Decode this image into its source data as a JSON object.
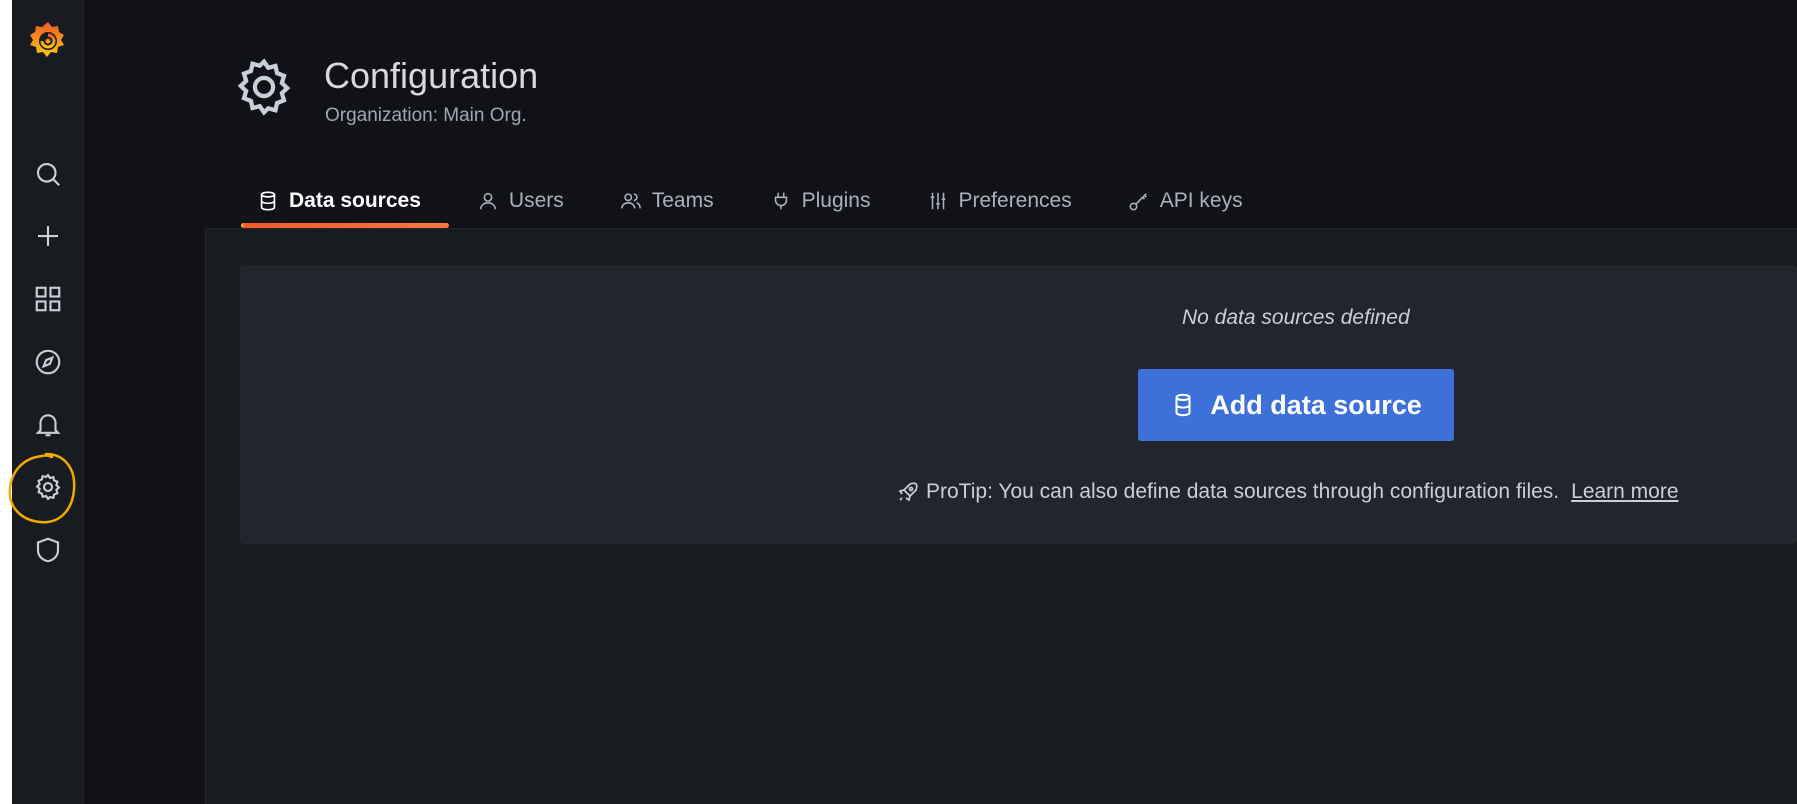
{
  "header": {
    "title": "Configuration",
    "subtitle": "Organization: Main Org."
  },
  "tabs": [
    {
      "label": "Data sources",
      "icon": "database-icon",
      "active": true
    },
    {
      "label": "Users",
      "icon": "user-icon",
      "active": false
    },
    {
      "label": "Teams",
      "icon": "users-icon",
      "active": false
    },
    {
      "label": "Plugins",
      "icon": "plug-icon",
      "active": false
    },
    {
      "label": "Preferences",
      "icon": "sliders-icon",
      "active": false
    },
    {
      "label": "API keys",
      "icon": "key-icon",
      "active": false
    }
  ],
  "sidebar": {
    "items": [
      {
        "icon": "search-icon"
      },
      {
        "icon": "plus-icon"
      },
      {
        "icon": "dashboards-grid-icon"
      },
      {
        "icon": "compass-icon"
      },
      {
        "icon": "bell-icon"
      },
      {
        "icon": "gear-icon",
        "highlighted": true
      },
      {
        "icon": "shield-icon"
      }
    ]
  },
  "empty_state": {
    "message": "No data sources defined",
    "button_label": "Add data source",
    "protip": "ProTip: You can also define data sources through configuration files.",
    "link_label": "Learn more"
  },
  "colors": {
    "background": "#111217",
    "sidebar": "#181b1f",
    "primary_button": "#3d71d9",
    "active_tab_underline": "#f05a28",
    "highlight_ring": "#f2a900"
  }
}
